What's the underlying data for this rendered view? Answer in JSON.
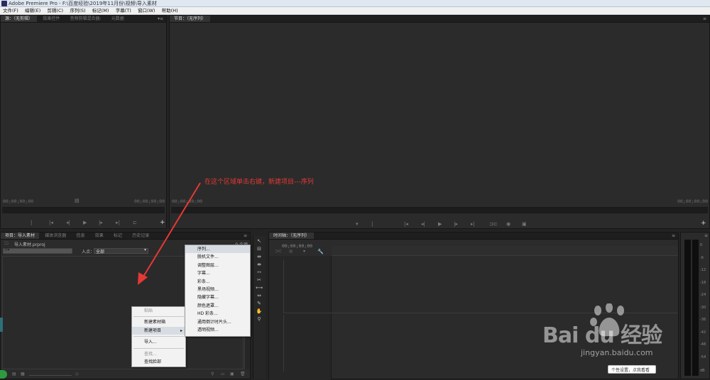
{
  "window": {
    "title": "Adobe Premiere Pro - F:\\百度经验\\2019年11月份\\视频\\导入素材"
  },
  "menubar": {
    "items": [
      "文件(F)",
      "编辑(E)",
      "剪辑(C)",
      "序列(S)",
      "标记(M)",
      "字幕(T)",
      "窗口(W)",
      "帮助(H)"
    ]
  },
  "source_panel": {
    "tabs": [
      "源：（无剪辑）",
      "效果控件",
      "音频剪辑混合器:",
      "元数据"
    ],
    "timecode_left": "00;00;00;00",
    "timecode_right": "00;00;00;00"
  },
  "program_panel": {
    "tabs": [
      "节目：（无序列）"
    ],
    "timecode_left": "00;00;00;00",
    "timecode_right": "00;00;00;00"
  },
  "project_panel": {
    "tabs": [
      "项目：导入素材",
      "媒体浏览器",
      "信息",
      "效果",
      "标记",
      "历史记录"
    ],
    "file": "导入素材.prproj",
    "item_count": "0 个项",
    "search_placeholder": "",
    "inpoint_label": "入点：",
    "inpoint_value": "全部"
  },
  "timeline_panel": {
    "tabs": [
      "时间轴：（无序列）"
    ],
    "timecode": "00;00;00;00"
  },
  "annotation": {
    "text": "在这个区域单击右键，新建项目---序列",
    "color": "#e53935"
  },
  "context_menu": {
    "items": [
      {
        "label": "粘贴",
        "disabled": true
      },
      {
        "label": "新建素材箱",
        "disabled": false
      },
      {
        "label": "新建项目",
        "disabled": false,
        "submenu": true
      },
      {
        "label": "导入...",
        "disabled": false
      },
      {
        "label": "查找...",
        "disabled": true
      },
      {
        "label": "查找脸部",
        "disabled": false
      }
    ]
  },
  "submenu": {
    "items": [
      "序列...",
      "脱机文件...",
      "调整图层...",
      "字幕...",
      "彩条...",
      "黑场视频...",
      "隐藏字幕...",
      "颜色遮罩...",
      "HD 彩条...",
      "通用倒计时片头...",
      "透明视频..."
    ]
  },
  "meter": {
    "levels": [
      "0",
      "-6",
      "-12",
      "-18",
      "-24",
      "-30",
      "-36",
      "-42",
      "-48",
      "-54",
      "dB"
    ]
  },
  "watermark": {
    "brand": "Bai du 经验",
    "url": "jingyan.baidu.com",
    "tooltip": "个性设置，点我看看"
  }
}
